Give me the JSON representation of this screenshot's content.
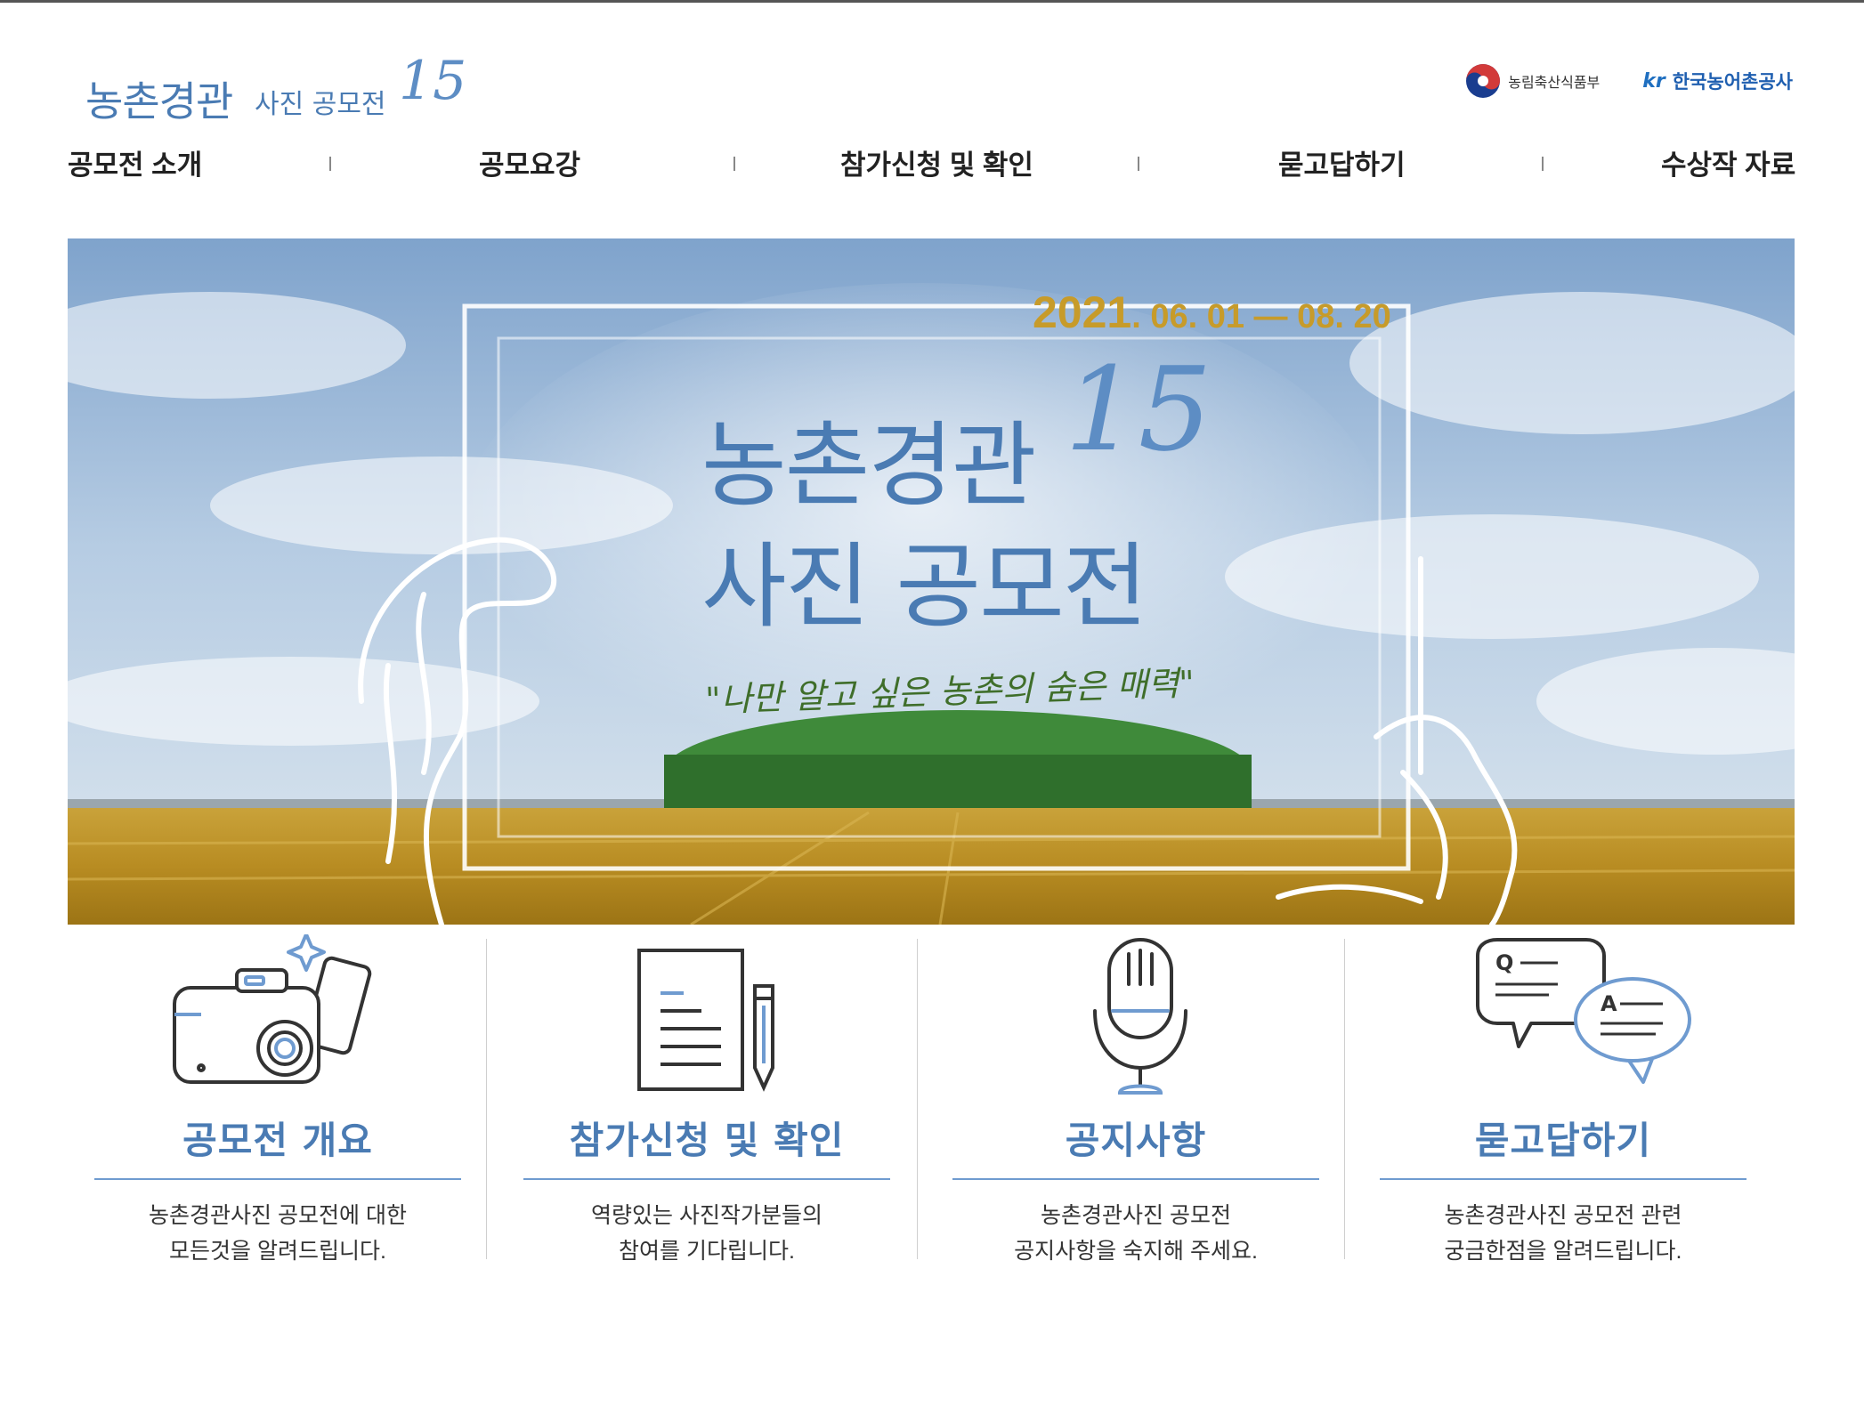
{
  "header": {
    "logo_main": "농촌경관",
    "logo_sub": "사진 공모전",
    "logo_number": "15",
    "org1_name": "농림축산식품부",
    "org2_mark": "kr",
    "org2_name": "한국농어촌공사"
  },
  "nav": {
    "items": [
      {
        "label": "공모전 소개"
      },
      {
        "label": "공모요강"
      },
      {
        "label": "참가신청 및 확인"
      },
      {
        "label": "묻고답하기"
      },
      {
        "label": "수상작 자료"
      }
    ]
  },
  "banner": {
    "date_year": "2021",
    "date_range": ". 06. 01 — 08. 20",
    "title_line1": "농촌경관",
    "title_number": "15",
    "title_line2": "사진 공모전",
    "quote": "\"나만 알고 싶은 농촌의 숨은 매력\""
  },
  "cards": [
    {
      "icon": "camera-phone-icon",
      "title": "공모전 개요",
      "desc_line1": "농촌경관사진 공모전에 대한",
      "desc_line2": "모든것을 알려드립니다."
    },
    {
      "icon": "document-pen-icon",
      "title": "참가신청 및 확인",
      "desc_line1": "역량있는 사진작가분들의",
      "desc_line2": "참여를 기다립니다."
    },
    {
      "icon": "microphone-icon",
      "title": "공지사항",
      "desc_line1": "농촌경관사진 공모전",
      "desc_line2": "공지사항을 숙지해 주세요."
    },
    {
      "icon": "qa-bubbles-icon",
      "title": "묻고답하기",
      "desc_line1": "농촌경관사진 공모전 관련",
      "desc_line2": "궁금한점을 알려드립니다."
    }
  ],
  "colors": {
    "accent_blue": "#4a7bb3",
    "date_gold": "#c79b2a",
    "icon_blue": "#6f9bd0",
    "icon_dark": "#333333"
  }
}
